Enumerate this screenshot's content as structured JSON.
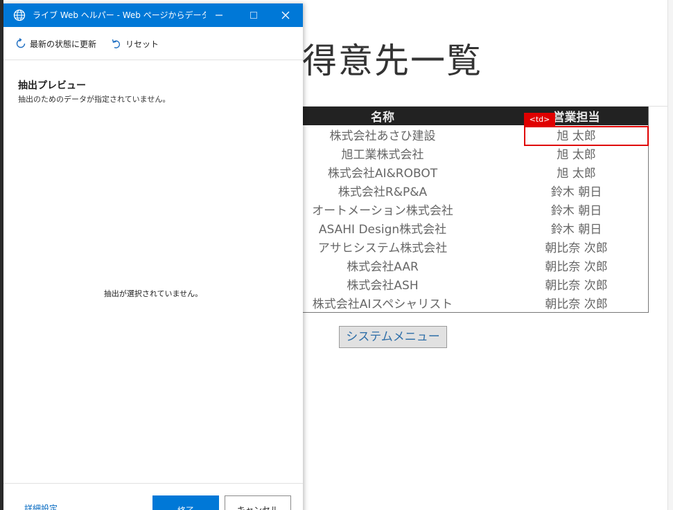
{
  "helper": {
    "window_title": "ライブ Web ヘルパー - Web ページからデータを…",
    "toolbar": {
      "refresh_label": "最新の状態に更新",
      "reset_label": "リセット"
    },
    "preview_heading": "抽出プレビュー",
    "preview_subtext": "抽出のためのデータが指定されていません。",
    "empty_message": "抽出が選択されていません。",
    "footer": {
      "advanced_label": "詳細設定",
      "finish_label": "終了",
      "cancel_label": "キャンセル"
    }
  },
  "webpage": {
    "title": "得意先一覧",
    "table": {
      "headers": [
        "名称",
        "営業担当"
      ],
      "rows": [
        [
          "株式会社あさひ建設",
          "旭 太郎"
        ],
        [
          "旭工業株式会社",
          "旭 太郎"
        ],
        [
          "株式会社AI&ROBOT",
          "旭 太郎"
        ],
        [
          "株式会社R&P&A",
          "鈴木 朝日"
        ],
        [
          "オートメーション株式会社",
          "鈴木 朝日"
        ],
        [
          "ASAHI Design株式会社",
          "鈴木 朝日"
        ],
        [
          "アサヒシステム株式会社",
          "朝比奈 次郎"
        ],
        [
          "株式会社AAR",
          "朝比奈 次郎"
        ],
        [
          "株式会社ASH",
          "朝比奈 次郎"
        ],
        [
          "株式会社AIスペシャリスト",
          "朝比奈 次郎"
        ]
      ]
    },
    "highlight_tag": "<td>",
    "system_menu_label": "システムメニュー"
  },
  "colors": {
    "titlebar": "#0078d7",
    "highlight": "#e00000",
    "table_header": "#222222",
    "link": "#0067c0"
  }
}
